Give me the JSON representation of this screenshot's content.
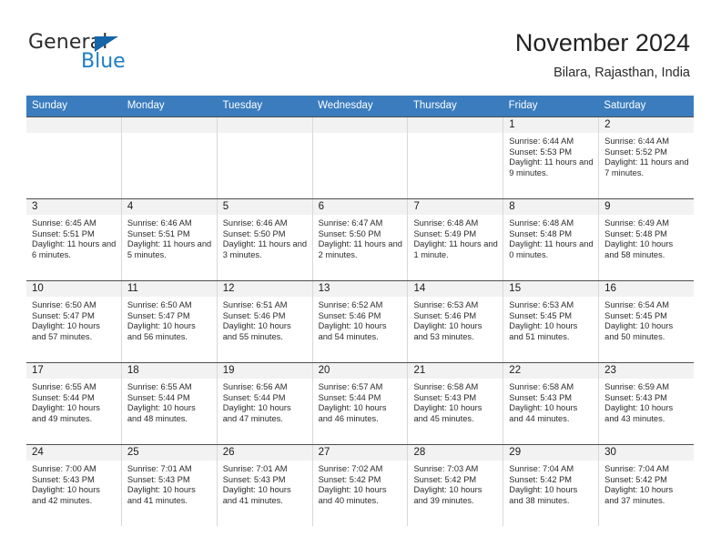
{
  "brand": {
    "name_part1": "General",
    "name_part2": "Blue",
    "logo_icon": "triangle-icon",
    "color_primary": "#1f7ec4",
    "color_triangle": "#1565a8"
  },
  "header": {
    "title": "November 2024",
    "subtitle": "Bilara, Rajasthan, India"
  },
  "theme": {
    "header_row_bg": "#3a7cbe",
    "header_row_text": "#ffffff",
    "day_band_bg": "#f2f2f2",
    "cell_border": "#d8d8d8",
    "row_divider": "#4f4f4f"
  },
  "weekdays": [
    "Sunday",
    "Monday",
    "Tuesday",
    "Wednesday",
    "Thursday",
    "Friday",
    "Saturday"
  ],
  "weeks": [
    [
      {
        "date": "",
        "empty": true,
        "sunrise": "",
        "sunset": "",
        "daylight": ""
      },
      {
        "date": "",
        "empty": true,
        "sunrise": "",
        "sunset": "",
        "daylight": ""
      },
      {
        "date": "",
        "empty": true,
        "sunrise": "",
        "sunset": "",
        "daylight": ""
      },
      {
        "date": "",
        "empty": true,
        "sunrise": "",
        "sunset": "",
        "daylight": ""
      },
      {
        "date": "",
        "empty": true,
        "sunrise": "",
        "sunset": "",
        "daylight": ""
      },
      {
        "date": "1",
        "empty": false,
        "sunrise": "Sunrise: 6:44 AM",
        "sunset": "Sunset: 5:53 PM",
        "daylight": "Daylight: 11 hours and 9 minutes."
      },
      {
        "date": "2",
        "empty": false,
        "sunrise": "Sunrise: 6:44 AM",
        "sunset": "Sunset: 5:52 PM",
        "daylight": "Daylight: 11 hours and 7 minutes."
      }
    ],
    [
      {
        "date": "3",
        "empty": false,
        "sunrise": "Sunrise: 6:45 AM",
        "sunset": "Sunset: 5:51 PM",
        "daylight": "Daylight: 11 hours and 6 minutes."
      },
      {
        "date": "4",
        "empty": false,
        "sunrise": "Sunrise: 6:46 AM",
        "sunset": "Sunset: 5:51 PM",
        "daylight": "Daylight: 11 hours and 5 minutes."
      },
      {
        "date": "5",
        "empty": false,
        "sunrise": "Sunrise: 6:46 AM",
        "sunset": "Sunset: 5:50 PM",
        "daylight": "Daylight: 11 hours and 3 minutes."
      },
      {
        "date": "6",
        "empty": false,
        "sunrise": "Sunrise: 6:47 AM",
        "sunset": "Sunset: 5:50 PM",
        "daylight": "Daylight: 11 hours and 2 minutes."
      },
      {
        "date": "7",
        "empty": false,
        "sunrise": "Sunrise: 6:48 AM",
        "sunset": "Sunset: 5:49 PM",
        "daylight": "Daylight: 11 hours and 1 minute."
      },
      {
        "date": "8",
        "empty": false,
        "sunrise": "Sunrise: 6:48 AM",
        "sunset": "Sunset: 5:48 PM",
        "daylight": "Daylight: 11 hours and 0 minutes."
      },
      {
        "date": "9",
        "empty": false,
        "sunrise": "Sunrise: 6:49 AM",
        "sunset": "Sunset: 5:48 PM",
        "daylight": "Daylight: 10 hours and 58 minutes."
      }
    ],
    [
      {
        "date": "10",
        "empty": false,
        "sunrise": "Sunrise: 6:50 AM",
        "sunset": "Sunset: 5:47 PM",
        "daylight": "Daylight: 10 hours and 57 minutes."
      },
      {
        "date": "11",
        "empty": false,
        "sunrise": "Sunrise: 6:50 AM",
        "sunset": "Sunset: 5:47 PM",
        "daylight": "Daylight: 10 hours and 56 minutes."
      },
      {
        "date": "12",
        "empty": false,
        "sunrise": "Sunrise: 6:51 AM",
        "sunset": "Sunset: 5:46 PM",
        "daylight": "Daylight: 10 hours and 55 minutes."
      },
      {
        "date": "13",
        "empty": false,
        "sunrise": "Sunrise: 6:52 AM",
        "sunset": "Sunset: 5:46 PM",
        "daylight": "Daylight: 10 hours and 54 minutes."
      },
      {
        "date": "14",
        "empty": false,
        "sunrise": "Sunrise: 6:53 AM",
        "sunset": "Sunset: 5:46 PM",
        "daylight": "Daylight: 10 hours and 53 minutes."
      },
      {
        "date": "15",
        "empty": false,
        "sunrise": "Sunrise: 6:53 AM",
        "sunset": "Sunset: 5:45 PM",
        "daylight": "Daylight: 10 hours and 51 minutes."
      },
      {
        "date": "16",
        "empty": false,
        "sunrise": "Sunrise: 6:54 AM",
        "sunset": "Sunset: 5:45 PM",
        "daylight": "Daylight: 10 hours and 50 minutes."
      }
    ],
    [
      {
        "date": "17",
        "empty": false,
        "sunrise": "Sunrise: 6:55 AM",
        "sunset": "Sunset: 5:44 PM",
        "daylight": "Daylight: 10 hours and 49 minutes."
      },
      {
        "date": "18",
        "empty": false,
        "sunrise": "Sunrise: 6:55 AM",
        "sunset": "Sunset: 5:44 PM",
        "daylight": "Daylight: 10 hours and 48 minutes."
      },
      {
        "date": "19",
        "empty": false,
        "sunrise": "Sunrise: 6:56 AM",
        "sunset": "Sunset: 5:44 PM",
        "daylight": "Daylight: 10 hours and 47 minutes."
      },
      {
        "date": "20",
        "empty": false,
        "sunrise": "Sunrise: 6:57 AM",
        "sunset": "Sunset: 5:44 PM",
        "daylight": "Daylight: 10 hours and 46 minutes."
      },
      {
        "date": "21",
        "empty": false,
        "sunrise": "Sunrise: 6:58 AM",
        "sunset": "Sunset: 5:43 PM",
        "daylight": "Daylight: 10 hours and 45 minutes."
      },
      {
        "date": "22",
        "empty": false,
        "sunrise": "Sunrise: 6:58 AM",
        "sunset": "Sunset: 5:43 PM",
        "daylight": "Daylight: 10 hours and 44 minutes."
      },
      {
        "date": "23",
        "empty": false,
        "sunrise": "Sunrise: 6:59 AM",
        "sunset": "Sunset: 5:43 PM",
        "daylight": "Daylight: 10 hours and 43 minutes."
      }
    ],
    [
      {
        "date": "24",
        "empty": false,
        "sunrise": "Sunrise: 7:00 AM",
        "sunset": "Sunset: 5:43 PM",
        "daylight": "Daylight: 10 hours and 42 minutes."
      },
      {
        "date": "25",
        "empty": false,
        "sunrise": "Sunrise: 7:01 AM",
        "sunset": "Sunset: 5:43 PM",
        "daylight": "Daylight: 10 hours and 41 minutes."
      },
      {
        "date": "26",
        "empty": false,
        "sunrise": "Sunrise: 7:01 AM",
        "sunset": "Sunset: 5:43 PM",
        "daylight": "Daylight: 10 hours and 41 minutes."
      },
      {
        "date": "27",
        "empty": false,
        "sunrise": "Sunrise: 7:02 AM",
        "sunset": "Sunset: 5:42 PM",
        "daylight": "Daylight: 10 hours and 40 minutes."
      },
      {
        "date": "28",
        "empty": false,
        "sunrise": "Sunrise: 7:03 AM",
        "sunset": "Sunset: 5:42 PM",
        "daylight": "Daylight: 10 hours and 39 minutes."
      },
      {
        "date": "29",
        "empty": false,
        "sunrise": "Sunrise: 7:04 AM",
        "sunset": "Sunset: 5:42 PM",
        "daylight": "Daylight: 10 hours and 38 minutes."
      },
      {
        "date": "30",
        "empty": false,
        "sunrise": "Sunrise: 7:04 AM",
        "sunset": "Sunset: 5:42 PM",
        "daylight": "Daylight: 10 hours and 37 minutes."
      }
    ]
  ]
}
